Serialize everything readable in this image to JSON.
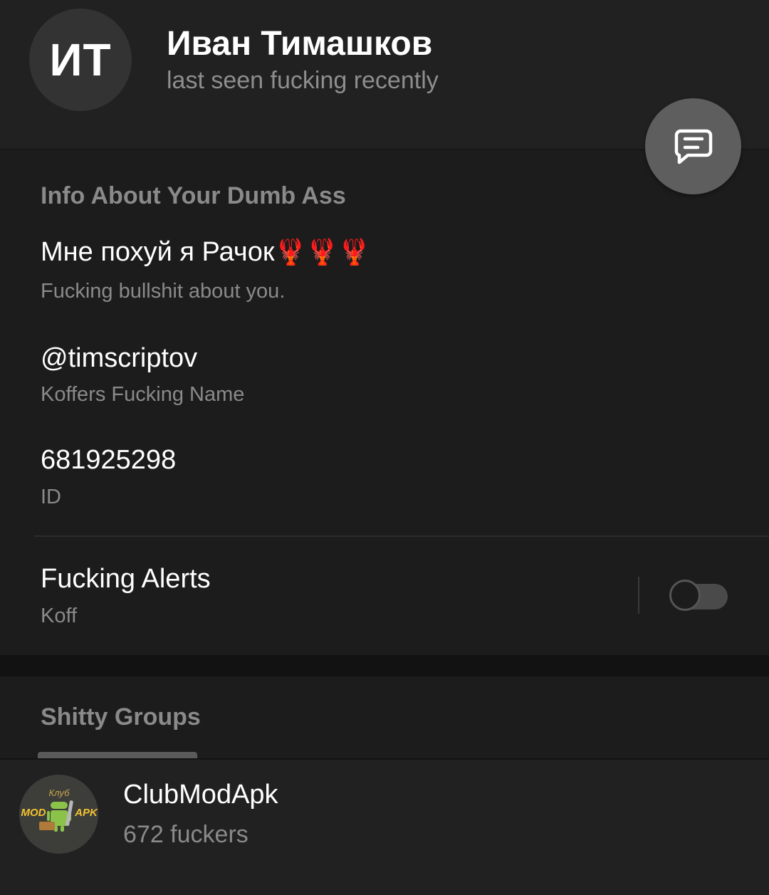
{
  "profile": {
    "avatar_initials": "ИТ",
    "name": "Иван Тимашков",
    "status": "last seen fucking recently"
  },
  "fab": {
    "icon": "message-icon"
  },
  "info": {
    "section_title": "Info About Your Dumb Ass",
    "bio": {
      "text": "Мне похуй я Рачок",
      "emoji": "🦞🦞🦞",
      "caption": "Fucking bullshit about you."
    },
    "username": {
      "value": "@timscriptov",
      "caption": "Koffers Fucking Name"
    },
    "id": {
      "value": "681925298",
      "caption": "ID"
    },
    "alerts": {
      "label": "Fucking Alerts",
      "caption": "Koff",
      "enabled": false
    }
  },
  "groups": {
    "section_title": "Shitty Groups",
    "items": [
      {
        "name": "ClubModApk",
        "members": "672 fuckers",
        "avatar_text_top": "Клуб",
        "avatar_text_left": "MOD",
        "avatar_text_right": "APK"
      }
    ]
  },
  "colors": {
    "background": "#1c1c1c",
    "header": "#212121",
    "text_primary": "#ffffff",
    "text_secondary": "#8a8a8a",
    "fab": "#5e5e5e",
    "group_logo_yellow": "#f2c230",
    "group_logo_green": "#8bc34a"
  }
}
